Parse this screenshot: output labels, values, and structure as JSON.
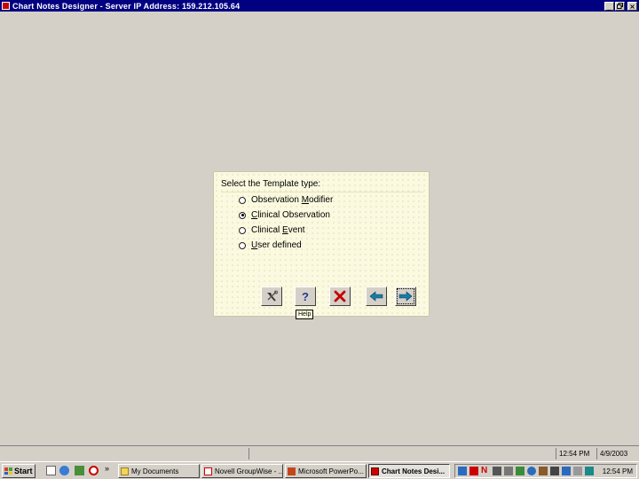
{
  "window": {
    "title": "Chart Notes Designer - Server IP Address: 159.212.105.64",
    "minimize": "_",
    "maximize": "5",
    "close": "×"
  },
  "dialog": {
    "prompt": "Select the Template type:",
    "options": [
      {
        "pre": "Observation ",
        "mnemonic": "M",
        "post": "odifier",
        "selected": false
      },
      {
        "pre": "",
        "mnemonic": "C",
        "post": "linical Observation",
        "selected": true
      },
      {
        "pre": "Clinical ",
        "mnemonic": "E",
        "post": "vent",
        "selected": false
      },
      {
        "pre": "",
        "mnemonic": "U",
        "post": "ser defined",
        "selected": false
      }
    ],
    "buttons": [
      {
        "name": "tools",
        "icon": "hammer-icon"
      },
      {
        "name": "help",
        "icon": "question-mark-icon"
      },
      {
        "name": "cancel",
        "icon": "red-x-icon"
      },
      {
        "name": "back",
        "icon": "left-arrow-icon"
      },
      {
        "name": "next",
        "icon": "right-arrow-icon",
        "focused": true
      }
    ],
    "tooltip": "Help"
  },
  "status_bar": {
    "time": "12:54 PM",
    "date": "4/9/2003"
  },
  "taskbar": {
    "start_label": "Start",
    "quicklaunch_more": "»",
    "tasks": [
      {
        "label": "My Documents",
        "active": false
      },
      {
        "label": "Novell GroupWise - ...",
        "active": false
      },
      {
        "label": "Microsoft PowerPo...",
        "active": false
      },
      {
        "label": "Chart Notes Desi...",
        "active": true
      }
    ],
    "clock": "12:54 PM",
    "colors": {
      "active_title": "#000080",
      "face": "#d4d0c8",
      "dialog_bg": "#fbfae0"
    }
  }
}
